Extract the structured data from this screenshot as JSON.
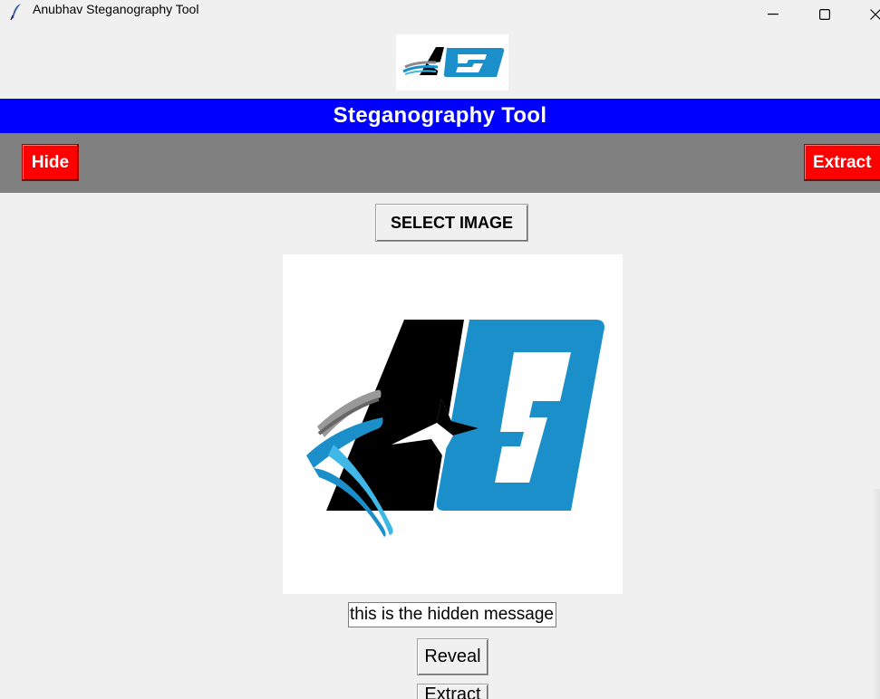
{
  "window": {
    "title": "Anubhav Steganography Tool",
    "icon": "feather-icon",
    "controls": [
      "minimize-icon",
      "maximize-icon",
      "close-icon"
    ]
  },
  "header": {
    "logo_text": "AS",
    "banner_title": "Steganography Tool"
  },
  "nav": {
    "hide_label": "Hide",
    "extract_label": "Extract"
  },
  "main": {
    "select_image_label": "SELECT IMAGE",
    "preview_logo_text": "AS",
    "message_value": "this is the hidden message",
    "reveal_label": "Reveal",
    "extract_label": "Extract"
  },
  "colors": {
    "banner": "#0000ff",
    "nav_bar": "#808080",
    "nav_button": "#ff0000",
    "logo_blue": "#1b8fca",
    "logo_black": "#000000"
  }
}
